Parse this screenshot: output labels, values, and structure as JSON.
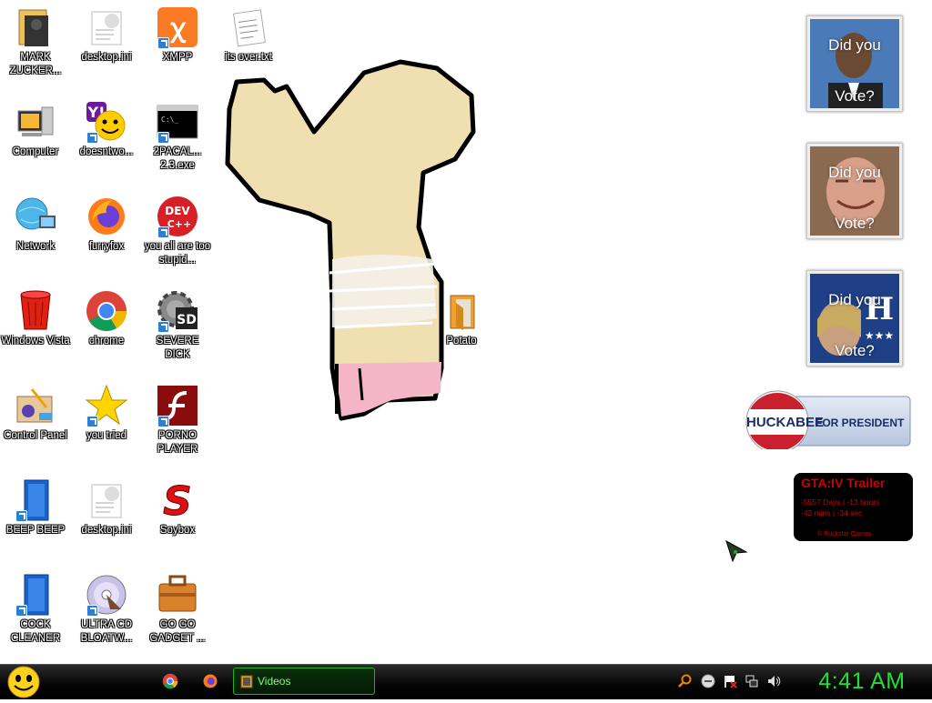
{
  "desktop_icons": [
    {
      "label": "MARK ZUCKER...",
      "icon": "fist-folder-icon"
    },
    {
      "label": "desktop.ini",
      "icon": "ini-file-icon"
    },
    {
      "label": "XMPP",
      "icon": "xampp-icon"
    },
    {
      "label": "its over.txt",
      "icon": "text-file-icon"
    },
    {
      "label": "Computer",
      "icon": "computer-icon"
    },
    {
      "label": "doesntwo...",
      "icon": "yahoo-messenger-icon"
    },
    {
      "label": "2PACAL... 2.3.exe",
      "icon": "command-prompt-icon"
    },
    {
      "label": "Network",
      "icon": "network-icon"
    },
    {
      "label": "furryfox",
      "icon": "firefox-icon"
    },
    {
      "label": "you all are too stupid...",
      "icon": "dev-cpp-icon"
    },
    {
      "label": "Windows Vista",
      "icon": "recycle-bin-icon"
    },
    {
      "label": "chrome",
      "icon": "chrome-icon"
    },
    {
      "label": "SEVERE DICK",
      "icon": "gear-sd-icon"
    },
    {
      "label": "Potato",
      "icon": "folder-icon"
    },
    {
      "label": "Control Panel",
      "icon": "control-panel-icon"
    },
    {
      "label": "you tried",
      "icon": "star-icon"
    },
    {
      "label": "PORNO PLAYER",
      "icon": "flash-player-icon"
    },
    {
      "label": "BEEP BEEP",
      "icon": "blue-panel-icon"
    },
    {
      "label": "desktop.ini",
      "icon": "ini-file-icon"
    },
    {
      "label": "Soybox",
      "icon": "soybox-icon"
    },
    {
      "label": "COCK CLEANER",
      "icon": "blue-panel-icon"
    },
    {
      "label": "ULTRA CD BLOATW...",
      "icon": "cd-icon"
    },
    {
      "label": "GO GO GADGET ...",
      "icon": "briefcase-icon"
    }
  ],
  "gadgets": {
    "photo1": {
      "caption_top": "Did you",
      "caption_bottom": "Vote?"
    },
    "photo2": {
      "caption_top": "Did you",
      "caption_bottom": "Vote?"
    },
    "photo3": {
      "caption_top": "Did you",
      "caption_bottom": "Vote?"
    },
    "huckabee": {
      "name": "HUCKABEE",
      "tagline": "FOR PRESIDENT"
    },
    "gta": {
      "title": "GTA:IV  Trailer",
      "line1": "-5557 Days | -13 hours",
      "line2": "-42 mins | -34 sec",
      "footer": "© Rockstar Games"
    }
  },
  "taskbar": {
    "task_label": "Videos",
    "clock": "4:41 AM"
  },
  "colors": {
    "clock": "#22dd33",
    "task_border": "#1bb31b",
    "gta_red": "#cc0000"
  }
}
